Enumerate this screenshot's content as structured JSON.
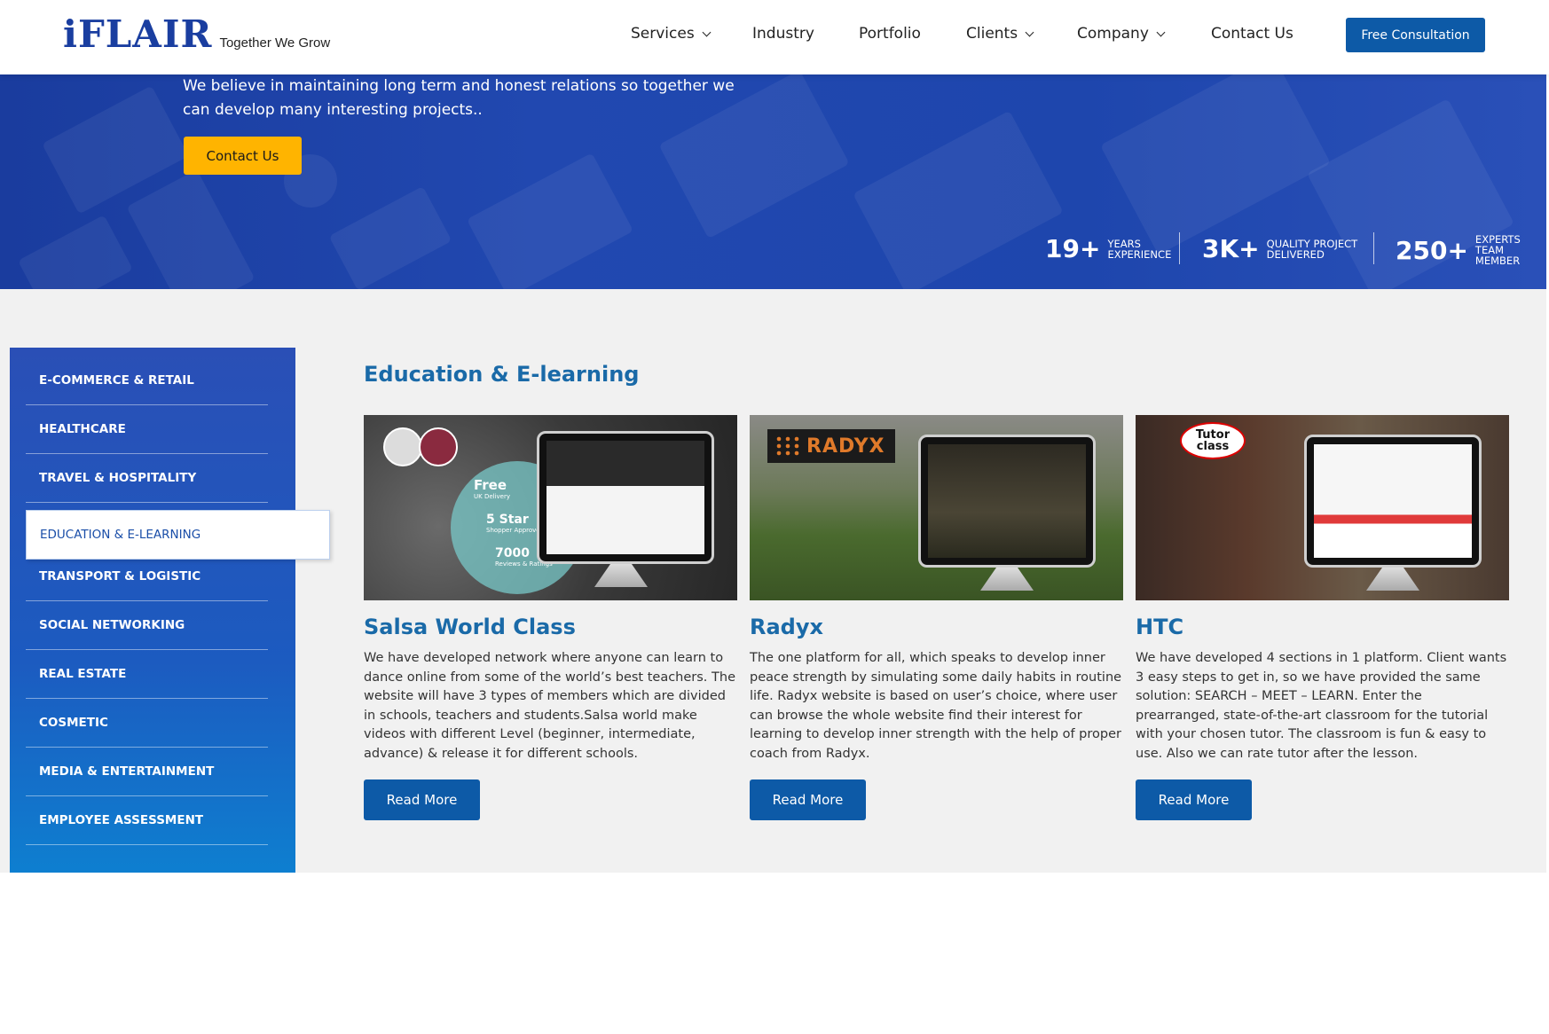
{
  "header": {
    "logo_text": "iFLAIR",
    "tagline": "Together We Grow",
    "nav": [
      {
        "label": "Services",
        "has_dropdown": true
      },
      {
        "label": "Industry",
        "has_dropdown": false
      },
      {
        "label": "Portfolio",
        "has_dropdown": false
      },
      {
        "label": "Clients",
        "has_dropdown": true
      },
      {
        "label": "Company",
        "has_dropdown": true
      },
      {
        "label": "Contact Us",
        "has_dropdown": false
      }
    ],
    "cta_label": "Free Consultation"
  },
  "hero": {
    "text": "We believe in maintaining long term and honest relations so together we can develop many interesting projects..",
    "button_label": "Contact Us",
    "stats": [
      {
        "value": "19+",
        "label_line1": "YEARS",
        "label_line2": "EXPERIENCE"
      },
      {
        "value": "3K+",
        "label_line1": "QUALITY PROJECT",
        "label_line2": "DELIVERED"
      },
      {
        "value": "250+",
        "label_line1": "EXPERTS",
        "label_line2": "TEAM MEMBER"
      }
    ]
  },
  "sidebar": {
    "items": [
      {
        "label": "E-COMMERCE & RETAIL",
        "active": false
      },
      {
        "label": "HEALTHCARE",
        "active": false
      },
      {
        "label": "TRAVEL & HOSPITALITY",
        "active": false
      },
      {
        "label": "EDUCATION & E-LEARNING",
        "active": true
      },
      {
        "label": "TRANSPORT & LOGISTIC",
        "active": false
      },
      {
        "label": "SOCIAL NETWORKING",
        "active": false
      },
      {
        "label": "REAL ESTATE",
        "active": false
      },
      {
        "label": "COSMETIC",
        "active": false
      },
      {
        "label": "MEDIA & ENTERTAINMENT",
        "active": false
      },
      {
        "label": "EMPLOYEE ASSESSMENT",
        "active": false
      }
    ]
  },
  "section": {
    "title": "Education & E-learning"
  },
  "cards": [
    {
      "title": "Salsa World Class",
      "description": "We have developed network where anyone can learn to dance online from some of the world’s best teachers. The website will have 3 types of members which are divided in schools, teachers and students.Salsa world make videos with different Level (beginner, intermediate, advance) & release it for different schools.",
      "button_label": "Read More",
      "image_texts": {
        "free": "Free",
        "free_sub": "UK Delivery",
        "star": "5 Star",
        "star_sub": "Shopper Approved",
        "reviews": "7000",
        "reviews_sub": "Reviews & Ratings"
      }
    },
    {
      "title": "Radyx",
      "description": "The one platform for all, which speaks to develop inner peace strength by simulating some daily habits in routine life. Radyx website is based on user’s choice, where user can browse the whole website find their interest for learning to develop inner strength with the help of proper coach from Radyx.",
      "button_label": "Read More",
      "image_texts": {
        "brand": "RADYX"
      }
    },
    {
      "title": "HTC",
      "description": "We have developed 4 sections in 1 platform. Client wants 3 easy steps to get in, so we have provided the same solution: SEARCH – MEET – LEARN. Enter the prearranged, state-of-the-art classroom for the tutorial with your chosen tutor. The classroom is fun & easy to use. Also we can rate tutor after the lesson.",
      "button_label": "Read More",
      "image_texts": {
        "brand": "Tutor class"
      }
    }
  ],
  "colors": {
    "brand_blue": "#0d5aa7",
    "heading_blue": "#1a6aa8",
    "accent_yellow": "#ffb400",
    "hero_blue": "#1e46ad"
  }
}
